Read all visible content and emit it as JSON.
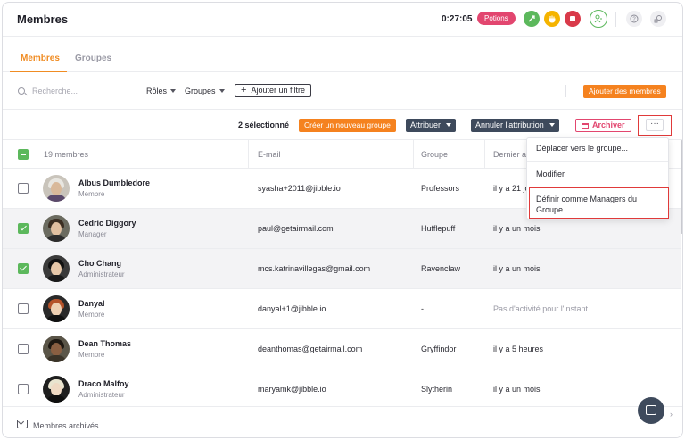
{
  "header": {
    "title": "Membres",
    "timer": "0:27:05",
    "potions_badge": "Potions"
  },
  "tabs": [
    {
      "label": "Membres",
      "active": true
    },
    {
      "label": "Groupes",
      "active": false
    }
  ],
  "filters": {
    "search_placeholder": "Recherche...",
    "roles_label": "Rôles",
    "groups_label": "Groupes",
    "add_filter_label": "Ajouter un filtre",
    "add_members_label": "Ajouter des membres"
  },
  "actions": {
    "selected_count": "2 sélectionné",
    "create_group": "Créer un nouveau groupe",
    "assign": "Attribuer",
    "unassign": "Annuler l'attribution",
    "archive": "Archiver",
    "more": "···"
  },
  "menu": {
    "items": [
      "Déplacer vers le groupe...",
      "Modifier",
      "Définir comme Managers du Groupe"
    ]
  },
  "table": {
    "columns": {
      "members": "19 membres",
      "email": "E-mail",
      "group": "Groupe",
      "last_activity": "Dernier ac"
    },
    "rows": [
      {
        "name": "Albus Dumbledore",
        "role": "Membre",
        "email": "syasha+2011@jibble.io",
        "group": "Professors",
        "last": "il y a 21 jo",
        "selected": false
      },
      {
        "name": "Cedric Diggory",
        "role": "Manager",
        "email": "paul@getairmail.com",
        "group": "Hufflepuff",
        "last": "il y a un mois",
        "selected": true
      },
      {
        "name": "Cho Chang",
        "role": "Administrateur",
        "email": "mcs.katrinavillegas@gmail.com",
        "group": "Ravenclaw",
        "last": "il y a un mois",
        "selected": true
      },
      {
        "name": "Danyal",
        "role": "Membre",
        "email": "danyal+1@jibble.io",
        "group": "-",
        "last": "Pas d'activité pour l'instant",
        "selected": false
      },
      {
        "name": "Dean Thomas",
        "role": "Membre",
        "email": "deanthomas@getairmail.com",
        "group": "Gryffindor",
        "last": "il y a 5 heures",
        "selected": false
      },
      {
        "name": "Draco Malfoy",
        "role": "Administrateur",
        "email": "maryamk@jibble.io",
        "group": "Slytherin",
        "last": "il y a un mois",
        "selected": false
      }
    ]
  },
  "footer": {
    "archived_label": "Membres archivés"
  },
  "colors": {
    "accent_orange": "#f5821f",
    "potions_pink": "#e2466f",
    "check_green": "#5cb85c",
    "dark_button": "#3e4a5c"
  }
}
